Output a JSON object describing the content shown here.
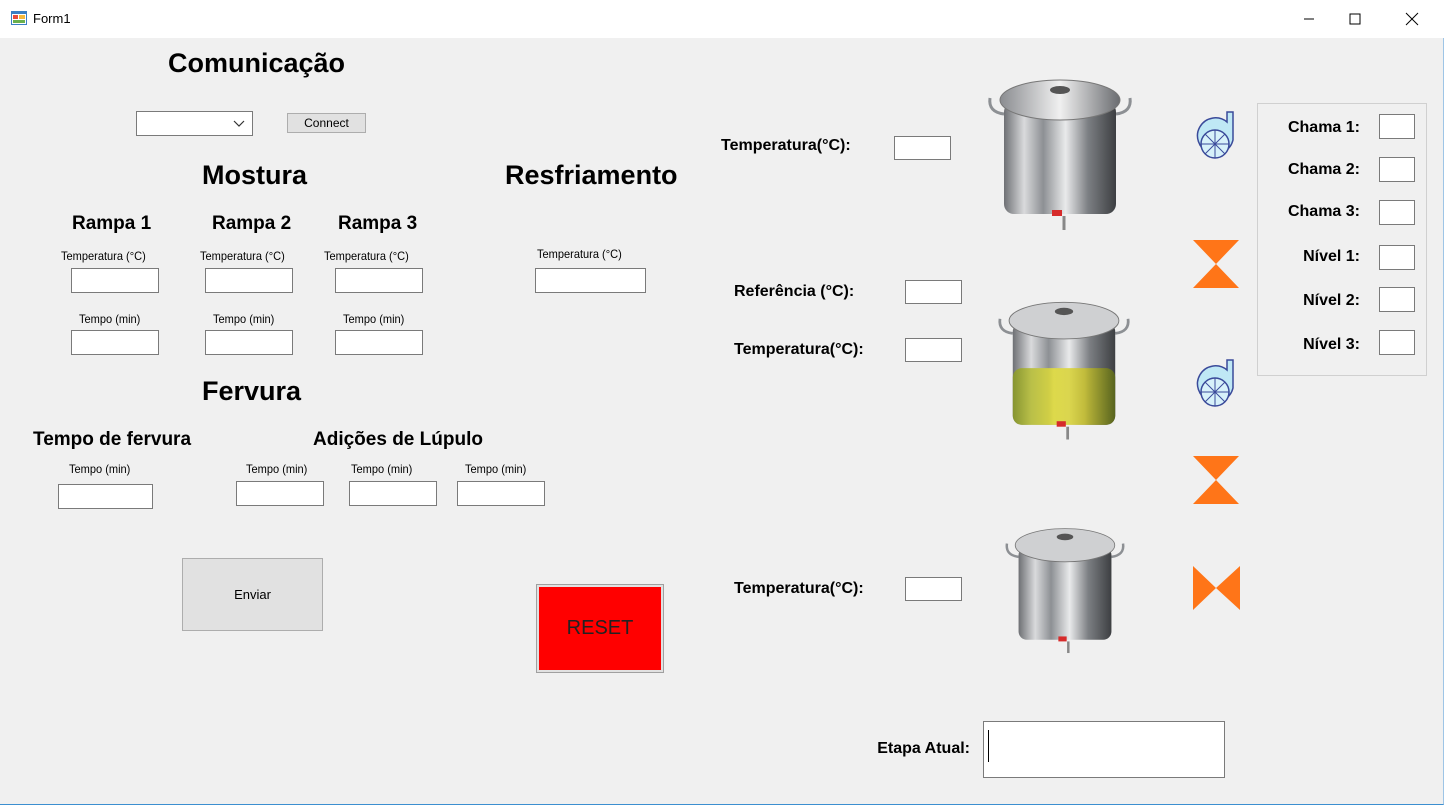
{
  "window": {
    "title": "Form1"
  },
  "communication": {
    "heading": "Comunicação",
    "port_value": "",
    "connect_label": "Connect"
  },
  "mostura": {
    "heading": "Mostura",
    "ramps": [
      {
        "title": "Rampa 1",
        "temp_label": "Temperatura (°C)",
        "time_label": "Tempo (min)"
      },
      {
        "title": "Rampa 2",
        "temp_label": "Temperatura (°C)",
        "time_label": "Tempo (min)"
      },
      {
        "title": "Rampa 3",
        "temp_label": "Temperatura (°C)",
        "time_label": "Tempo (min)"
      }
    ]
  },
  "resfriamento": {
    "heading": "Resfriamento",
    "temp_label": "Temperatura (°C)"
  },
  "fervura": {
    "heading": "Fervura",
    "boil_time_heading": "Tempo de fervura",
    "boil_time_label": "Tempo (min)",
    "hops_heading": "Adições de Lúpulo",
    "hop_labels": [
      "Tempo (min)",
      "Tempo (min)",
      "Tempo (min)"
    ]
  },
  "actions": {
    "send_label": "Enviar",
    "reset_label": "RESET"
  },
  "tanks": {
    "tank1_temp_label": "Temperatura(°C):",
    "tank2_ref_label": "Referência (°C):",
    "tank2_temp_label": "Temperatura(°C):",
    "tank3_temp_label": "Temperatura(°C):"
  },
  "status_panel": {
    "labels": [
      "Chama 1:",
      "Chama 2:",
      "Chama 3:",
      "Nível 1:",
      "Nível 2:",
      "Nível 3:"
    ]
  },
  "current_step": {
    "label": "Etapa Atual:",
    "value": ""
  },
  "colors": {
    "reset_bg": "#ff0000",
    "valve": "#ff7518",
    "pump": "#bfe8f5"
  },
  "icons": [
    "app-icon",
    "minimize-icon",
    "maximize-icon",
    "close-icon",
    "chevron-down-icon",
    "pot-icon",
    "pump-icon",
    "valve-icon"
  ]
}
